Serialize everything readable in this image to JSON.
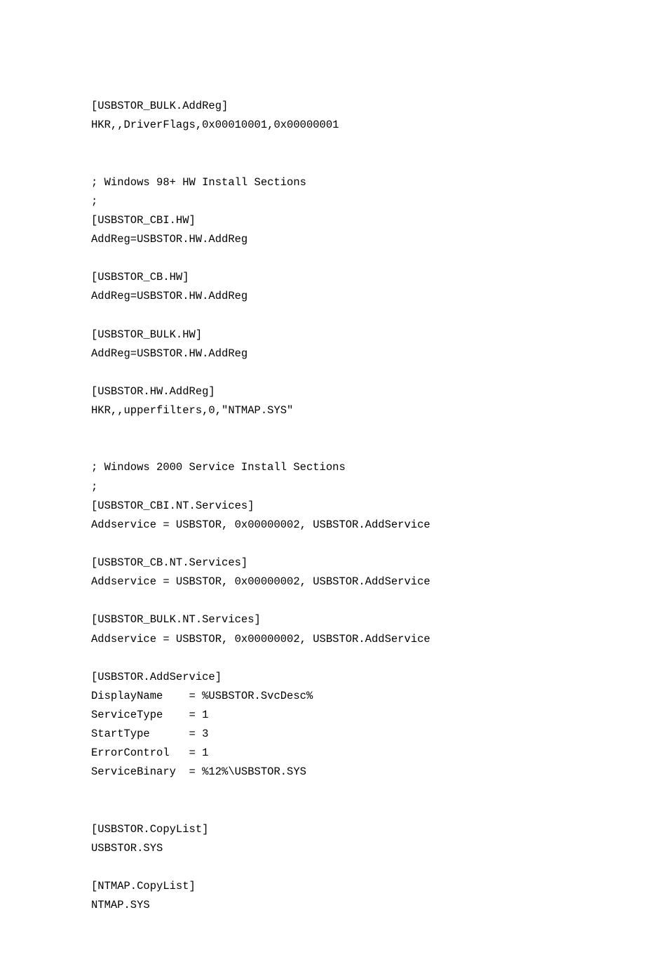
{
  "lines": [
    "[USBSTOR_BULK.AddReg]",
    "HKR,,DriverFlags,0x00010001,0x00000001",
    "",
    "",
    "; Windows 98+ HW Install Sections",
    ";",
    "[USBSTOR_CBI.HW]",
    "AddReg=USBSTOR.HW.AddReg",
    "",
    "[USBSTOR_CB.HW]",
    "AddReg=USBSTOR.HW.AddReg",
    "",
    "[USBSTOR_BULK.HW]",
    "AddReg=USBSTOR.HW.AddReg",
    "",
    "[USBSTOR.HW.AddReg]",
    "HKR,,upperfilters,0,\"NTMAP.SYS\"",
    "",
    "",
    "; Windows 2000 Service Install Sections",
    ";",
    "[USBSTOR_CBI.NT.Services]",
    "Addservice = USBSTOR, 0x00000002, USBSTOR.AddService",
    "",
    "[USBSTOR_CB.NT.Services]",
    "Addservice = USBSTOR, 0x00000002, USBSTOR.AddService",
    "",
    "[USBSTOR_BULK.NT.Services]",
    "Addservice = USBSTOR, 0x00000002, USBSTOR.AddService",
    "",
    "[USBSTOR.AddService]",
    "DisplayName    = %USBSTOR.SvcDesc%",
    "ServiceType    = 1",
    "StartType      = 3",
    "ErrorControl   = 1",
    "ServiceBinary  = %12%\\USBSTOR.SYS",
    "",
    "",
    "[USBSTOR.CopyList]",
    "USBSTOR.SYS",
    "",
    "[NTMAP.CopyList]",
    "NTMAP.SYS"
  ]
}
